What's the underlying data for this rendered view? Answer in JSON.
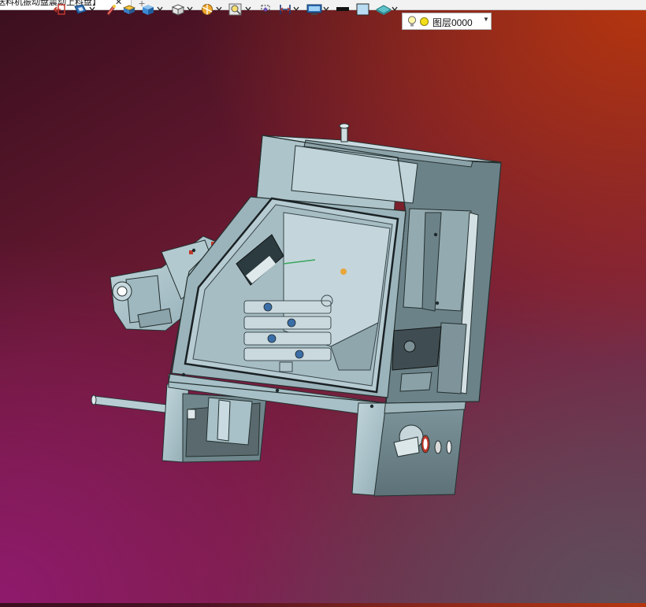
{
  "document_tab": {
    "title": "送料机振动盘震动上料盘】",
    "close_glyph": "✕",
    "new_tab_glyph": "+"
  },
  "toolbar": {
    "tools": [
      {
        "name": "exit-sketch-icon"
      },
      {
        "name": "view-orientation-icon"
      },
      {
        "name": "hide-show-icon"
      },
      {
        "name": "display-style-icon"
      },
      {
        "name": "shaded-cube-icon"
      },
      {
        "name": "view-cube-icon"
      },
      {
        "name": "section-view-icon"
      },
      {
        "name": "zoom-fit-icon"
      },
      {
        "name": "perspective-icon"
      },
      {
        "name": "measure-icon"
      },
      {
        "name": "screen-display-icon"
      },
      {
        "name": "line-color-icon"
      },
      {
        "name": "fill-color-icon"
      },
      {
        "name": "material-icon"
      }
    ],
    "layer_select": {
      "value": "图层0000",
      "bulb_icon": "lightbulb-icon",
      "color": "#f2df1a"
    }
  },
  "viewport": {
    "content": "3d-machine-assembly-model",
    "background_colors": [
      "#3a0f1e",
      "#b5360e",
      "#8e1a6c",
      "#5e4e5a"
    ],
    "model_color": "#a9c4cc"
  }
}
